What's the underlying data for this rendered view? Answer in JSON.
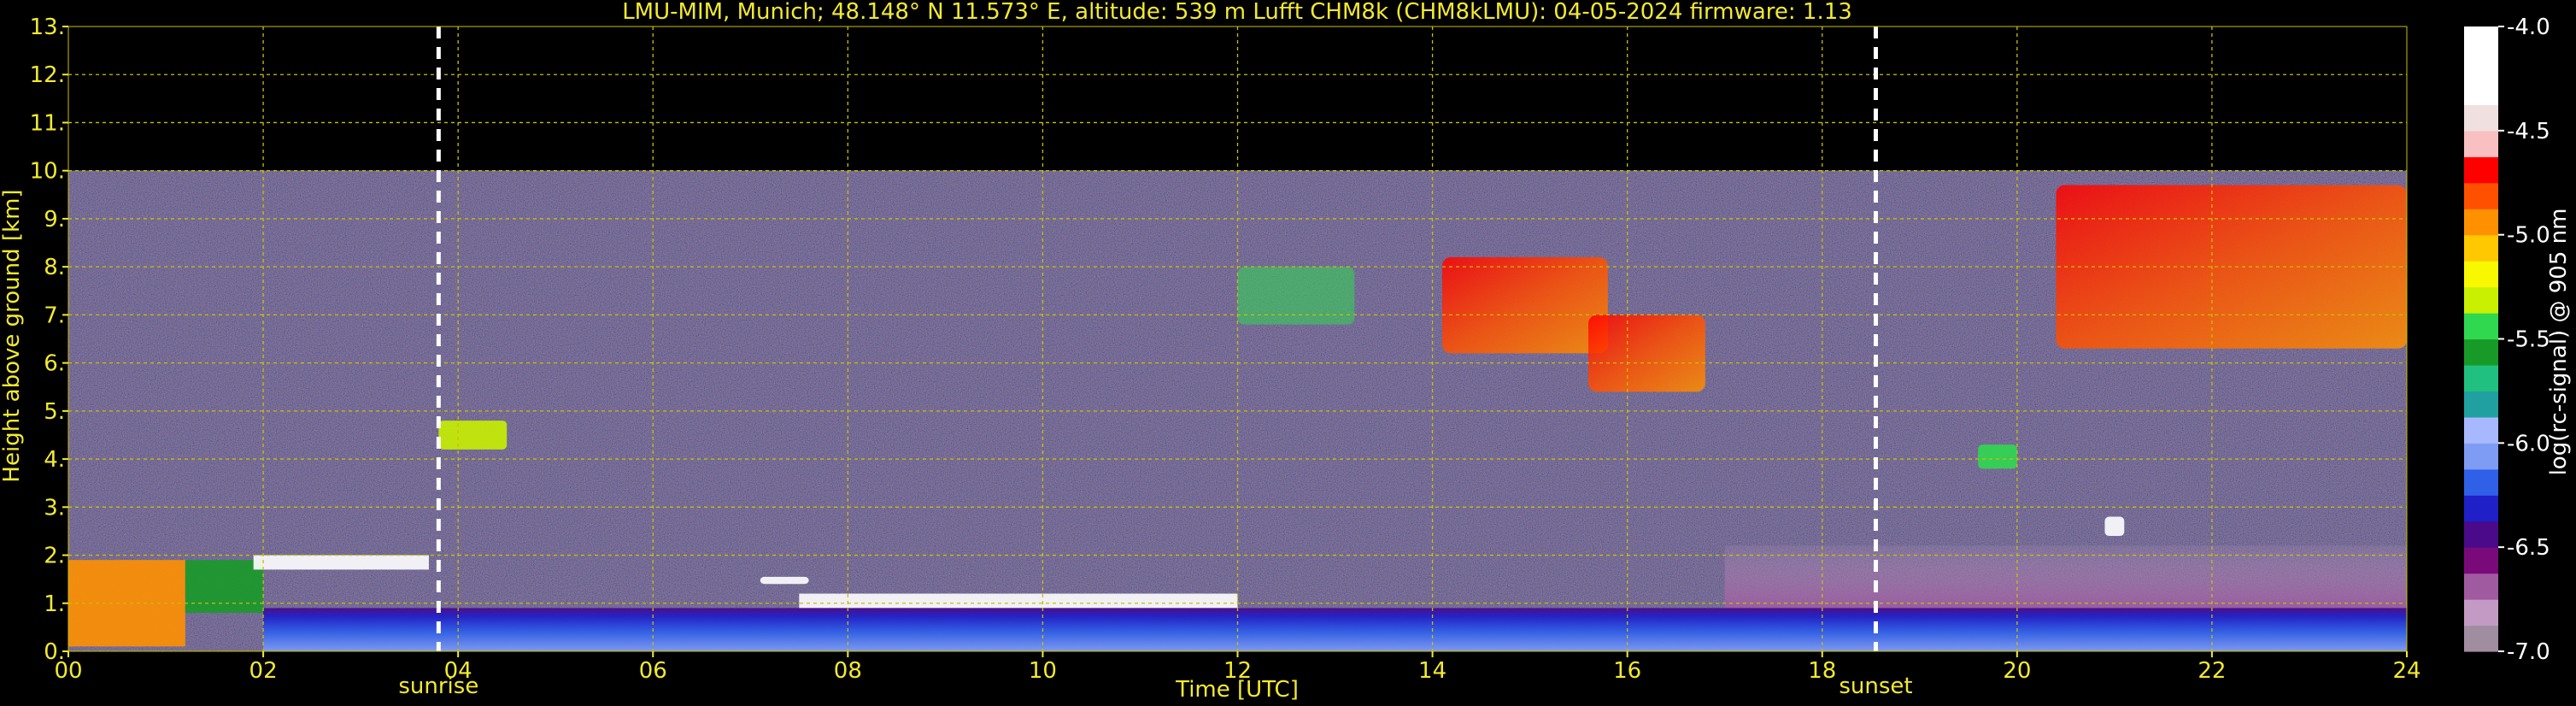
{
  "title": "LMU-MIM, Munich; 48.148° N 11.573° E, altitude: 539 m    Lufft CHM8k (CHM8kLMU): 04-05-2024    firmware: 1.13",
  "colors": {
    "background": "#000000",
    "axis_text": "#f2ea2e",
    "grid": "#c8c000",
    "marker_line": "#ffffff",
    "colorbar_label": "#ffffff"
  },
  "chart_data": {
    "type": "heatmap",
    "title": "LMU-MIM, Munich; 48.148° N 11.573° E, altitude: 539 m    Lufft CHM8k (CHM8kLMU): 04-05-2024    firmware: 1.13",
    "xlabel": "Time [UTC]",
    "ylabel": "Height above ground [km]",
    "xlim": [
      0,
      24
    ],
    "ylim": [
      0,
      13
    ],
    "x_ticks": [
      0,
      2,
      4,
      6,
      8,
      10,
      12,
      14,
      16,
      18,
      20,
      22,
      24
    ],
    "x_tick_labels": [
      "00",
      "02",
      "04",
      "06",
      "08",
      "10",
      "12",
      "14",
      "16",
      "18",
      "20",
      "22",
      "24"
    ],
    "y_ticks": [
      0,
      1,
      2,
      3,
      4,
      5,
      6,
      7,
      8,
      9,
      10,
      11,
      12,
      13
    ],
    "y_tick_labels": [
      "0.",
      "1.",
      "2.",
      "3.",
      "4.",
      "5.",
      "6.",
      "7.",
      "8.",
      "9.",
      "10.",
      "11.",
      "12.",
      "13."
    ],
    "grid": true,
    "measurement_top_km": 10,
    "vertical_markers": [
      {
        "label": "sunrise",
        "x": 3.8
      },
      {
        "label": "sunset",
        "x": 18.55
      }
    ],
    "colorbar": {
      "label": "log(rc-signal) @ 905 nm",
      "range": [
        -7.0,
        -4.0
      ],
      "ticks": [
        -4.0,
        -4.5,
        -5.0,
        -5.5,
        -6.0,
        -6.5,
        -7.0
      ],
      "tick_labels": [
        "-4.0",
        "-4.5",
        "-5.0",
        "-5.5",
        "-6.0",
        "-6.5",
        "-7.0"
      ],
      "colors": [
        "#a08da0",
        "#c39ac3",
        "#a05aa0",
        "#7a0a7a",
        "#4a0a8a",
        "#2020c8",
        "#3060e8",
        "#7f9cf5",
        "#a8b8ff",
        "#20a0a0",
        "#20c080",
        "#189a28",
        "#30d850",
        "#c8f000",
        "#f8f800",
        "#ffc800",
        "#ff9000",
        "#ff5000",
        "#ff0000",
        "#f8c0c0",
        "#f0e0e0",
        "#ffffff",
        "#ffffff",
        "#ffffff"
      ]
    },
    "features": [
      {
        "name": "cloud layer",
        "x_range": [
          0.0,
          1.2
        ],
        "height_range_km": [
          0.1,
          1.9
        ],
        "log_signal": -5.0
      },
      {
        "name": "cloud layer",
        "x_range": [
          1.2,
          2.0
        ],
        "height_range_km": [
          0.8,
          1.9
        ],
        "log_signal": -5.6
      },
      {
        "name": "cloud layer",
        "x_range": [
          1.9,
          3.7
        ],
        "height_range_km": [
          1.7,
          2.0
        ],
        "log_signal": -4.3
      },
      {
        "name": "cloud",
        "x_range": [
          3.8,
          4.5
        ],
        "height_range_km": [
          4.2,
          4.8
        ],
        "log_signal": -5.3
      },
      {
        "name": "cloud",
        "x_range": [
          7.1,
          7.6
        ],
        "height_range_km": [
          1.4,
          1.55
        ],
        "log_signal": -4.3
      },
      {
        "name": "boundary layer top",
        "x_range": [
          7.5,
          12.0
        ],
        "height_range_km": [
          0.9,
          1.2
        ],
        "log_signal": -4.3
      },
      {
        "name": "cirrus",
        "x_range": [
          12.0,
          13.2
        ],
        "height_range_km": [
          6.8,
          8.0
        ],
        "log_signal": -5.5
      },
      {
        "name": "cirrus",
        "x_range": [
          14.1,
          15.8
        ],
        "height_range_km": [
          6.2,
          8.2
        ],
        "log_signal": -5.2
      },
      {
        "name": "cirrus",
        "x_range": [
          15.6,
          16.8
        ],
        "height_range_km": [
          5.4,
          7.0
        ],
        "log_signal": -4.8
      },
      {
        "name": "cloud",
        "x_range": [
          19.6,
          20.0
        ],
        "height_range_km": [
          3.8,
          4.3
        ],
        "log_signal": -5.5
      },
      {
        "name": "cloud",
        "x_range": [
          20.9,
          21.1
        ],
        "height_range_km": [
          2.4,
          2.8
        ],
        "log_signal": -4.3
      },
      {
        "name": "cirrus",
        "x_range": [
          20.4,
          24.0
        ],
        "height_range_km": [
          6.3,
          9.7
        ],
        "log_signal": -5.1
      },
      {
        "name": "aerosol layer",
        "x_range": [
          17.0,
          24.0
        ],
        "height_range_km": [
          0.9,
          2.2
        ],
        "log_signal": -6.8
      },
      {
        "name": "boundary layer",
        "x_range": [
          2.0,
          24.0
        ],
        "height_range_km": [
          0.0,
          0.9
        ],
        "log_signal": -6.2
      }
    ]
  }
}
